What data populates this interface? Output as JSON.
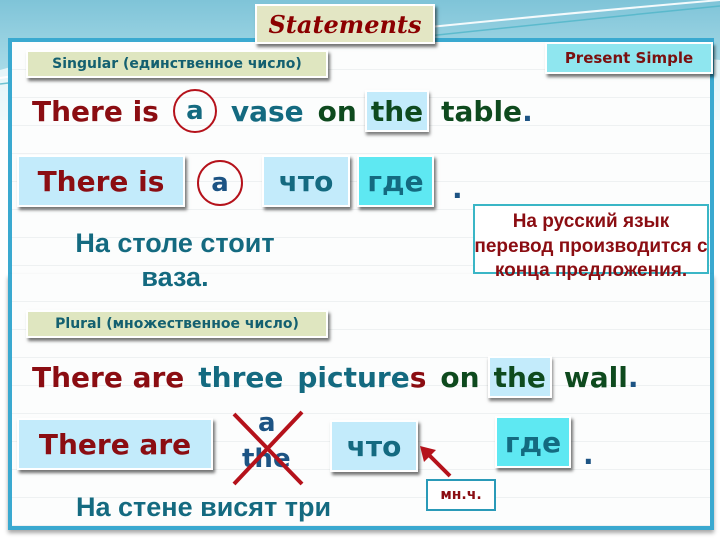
{
  "header": {
    "title": "Statements",
    "tense": "Present Simple"
  },
  "singular": {
    "label": "Singular (единственное число)",
    "sentence": {
      "there_is": "There is",
      "article": "a",
      "noun": "vase",
      "prep": "on",
      "article2": "the",
      "place": "table",
      "end": "."
    },
    "pattern": {
      "there_is": "There is",
      "article": "a",
      "what": "что",
      "where": "где",
      "end": "."
    },
    "translation": "На столе стоит ваза."
  },
  "note": {
    "text": "На русский язык перевод производится с конца предложения."
  },
  "plural": {
    "label": "Plural (множественное число)",
    "sentence": {
      "there_are": "There are",
      "number": "three",
      "noun_stem": "picture",
      "noun_suffix": "s",
      "prep": "on",
      "article2": "the",
      "place": "wall",
      "end": "."
    },
    "pattern": {
      "there_are": "There are",
      "crossed_article_1": "a",
      "crossed_article_2": "the",
      "what": "что",
      "where": "где",
      "end": ".",
      "plural_marker": "мн.ч."
    },
    "translation": "На стене висят три"
  },
  "colors": {
    "frame": "#3aa9d0",
    "dark_red": "#8b0d12",
    "teal": "#146a80",
    "green": "#0e4a1e",
    "tile_light": "#c3ebfb",
    "tile_cyan": "#5ee8f2"
  }
}
